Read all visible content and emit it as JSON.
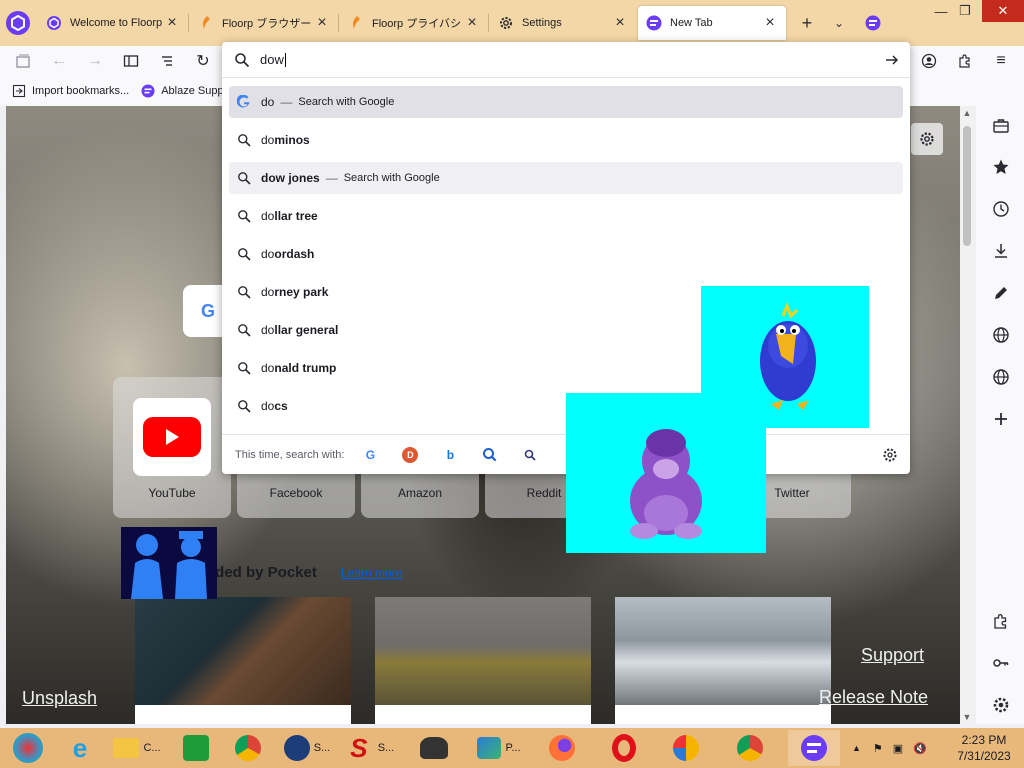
{
  "tabs": [
    {
      "title": "Welcome to Floorp !",
      "icon": "floorp-logo-icon",
      "selected": false
    },
    {
      "title": "Floorp ブラウザー",
      "icon": "floorp-flame-icon",
      "selected": false
    },
    {
      "title": "Floorp プライバシ",
      "icon": "floorp-flame-icon",
      "selected": false
    },
    {
      "title": "Settings",
      "icon": "gear-icon",
      "selected": false
    },
    {
      "title": "New Tab",
      "icon": "floorp-logo-icon",
      "selected": true
    }
  ],
  "urlbar": {
    "typed": "dow",
    "suggestions": [
      {
        "typed": "do",
        "rest": "",
        "action": "Search with Google",
        "icon": "google-icon",
        "state": "selected"
      },
      {
        "typed": "do",
        "rest": "minos",
        "action": "",
        "icon": "search-icon",
        "state": ""
      },
      {
        "typed": "dow",
        "rest": " jones",
        "action": "Search with Google",
        "icon": "search-icon",
        "state": "hover"
      },
      {
        "typed": "do",
        "rest": "llar tree",
        "action": "",
        "icon": "search-icon",
        "state": ""
      },
      {
        "typed": "do",
        "rest": "ordash",
        "action": "",
        "icon": "search-icon",
        "state": ""
      },
      {
        "typed": "do",
        "rest": "rney park",
        "action": "",
        "icon": "search-icon",
        "state": ""
      },
      {
        "typed": "do",
        "rest": "llar general",
        "action": "",
        "icon": "search-icon",
        "state": ""
      },
      {
        "typed": "do",
        "rest": "nald trump",
        "action": "",
        "icon": "search-icon",
        "state": ""
      },
      {
        "typed": "do",
        "rest": "cs",
        "action": "",
        "icon": "search-icon",
        "state": ""
      }
    ],
    "oneoff_label": "This time, search with:",
    "engines": [
      "google-icon",
      "duckduckgo-icon",
      "bing-icon",
      "search-icon",
      "wikipedia-icon"
    ]
  },
  "bookmarks": [
    {
      "label": "Import bookmarks...",
      "icon": "import-icon"
    },
    {
      "label": "Ablaze Support",
      "icon": "floorp-logo-icon"
    }
  ],
  "newtab": {
    "top_sites": [
      "YouTube",
      "Facebook",
      "Amazon",
      "Reddit",
      "Twitter"
    ],
    "pocket_heading": "nded by Pocket",
    "pocket_link": "Learn more",
    "unsplash": "Unsplash",
    "support": "Support",
    "release_note": "Release Note"
  },
  "sidebar_icons": [
    "briefcase-icon",
    "star-icon",
    "history-icon",
    "download-icon",
    "pen-icon",
    "globe-icon",
    "globe-icon",
    "plus-icon",
    "extension-icon",
    "key-icon",
    "gear-icon"
  ],
  "taskbar": {
    "items": [
      {
        "label": "",
        "icon": "app-icon"
      },
      {
        "label": "",
        "icon": "internet-explorer-icon"
      },
      {
        "label": "C...",
        "icon": "folder-icon"
      },
      {
        "label": "",
        "icon": "store-icon"
      },
      {
        "label": "",
        "icon": "chrome-icon"
      },
      {
        "label": "S...",
        "icon": "search-app-icon"
      },
      {
        "label": "S...",
        "icon": "s-app-icon"
      },
      {
        "label": "",
        "icon": "robot-icon"
      },
      {
        "label": "P...",
        "icon": "picture-icon"
      },
      {
        "label": "",
        "icon": "firefox-icon"
      },
      {
        "label": "",
        "icon": "opera-icon"
      },
      {
        "label": "",
        "icon": "lock-shield-icon"
      },
      {
        "label": "",
        "icon": "chrome-icon"
      },
      {
        "label": "",
        "icon": "floorp-logo-icon"
      }
    ],
    "time": "2:23 PM",
    "date": "7/31/2023"
  }
}
